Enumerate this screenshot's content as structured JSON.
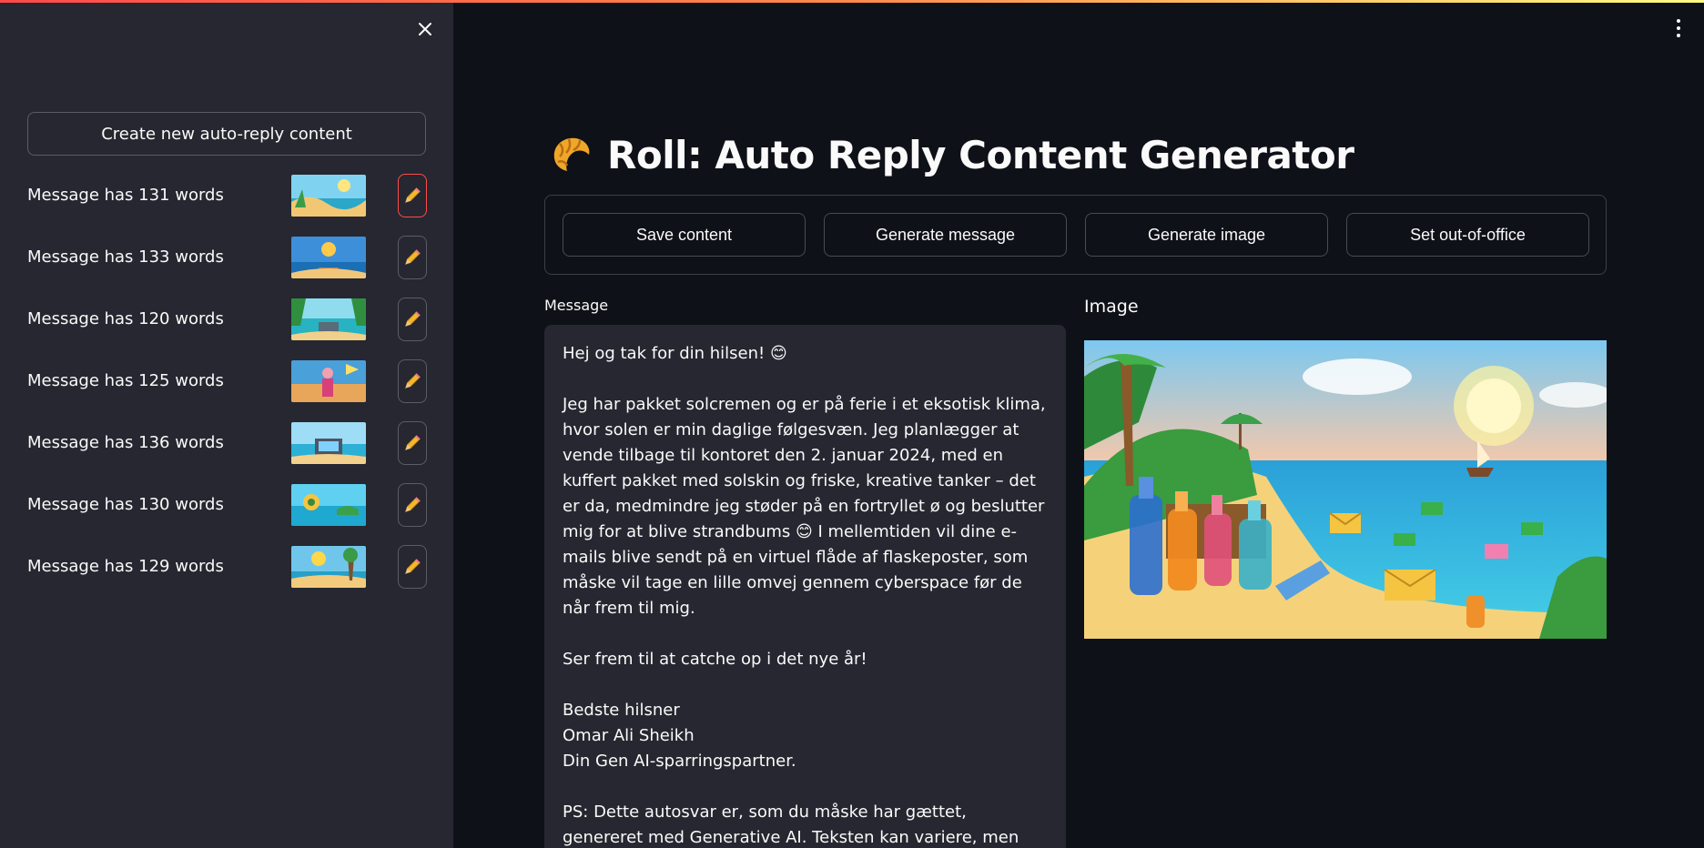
{
  "sidebar": {
    "create_label": "Create new auto-reply content",
    "items": [
      {
        "label": "Message has 131 words"
      },
      {
        "label": "Message has 133 words"
      },
      {
        "label": "Message has 120 words"
      },
      {
        "label": "Message has 125 words"
      },
      {
        "label": "Message has 136 words"
      },
      {
        "label": "Message has 130 words"
      },
      {
        "label": "Message has 129 words"
      }
    ]
  },
  "header": {
    "title": "Roll: Auto Reply Content Generator"
  },
  "toolbar": {
    "save_label": "Save content",
    "generate_message_label": "Generate message",
    "generate_image_label": "Generate image",
    "out_of_office_label": "Set out-of-office"
  },
  "main": {
    "message_label": "Message",
    "image_label": "Image",
    "message_text": "Hej og tak for din hilsen! 😊\n\nJeg har pakket solcremen og er på ferie i et eksotisk klima, hvor solen er min daglige følgesvæn. Jeg planlægger at vende tilbage til kontoret den 2. januar 2024, med en kuffert pakket med solskin og friske, kreative tanker – det er da, medmindre jeg støder på en fortryllet ø og beslutter mig for at blive strandbums 😊 I mellemtiden vil dine e-mails blive sendt på en virtuel flåde af flaskeposter, som måske vil tage en lille omvej gennem cyberspace før de når frem til mig.\n\nSer frem til at catche op i det nye år!\n\nBedste hilsner\nOmar Ali Sheikh\nDin Gen AI-sparringspartner.\n\nPS: Dette autosvar er, som du måske har gættet, genereret med Generative AI. Teksten kan variere, men budskabet forbliver konstant."
  },
  "colors": {
    "background": "#0e1117",
    "sidebar": "#262730",
    "accent": "#ff4b4b",
    "text": "#fafafa"
  },
  "icons": {
    "close": "close-icon",
    "menu": "kebab-menu-icon",
    "edit": "pencil-icon",
    "logo": "croissant-icon"
  }
}
